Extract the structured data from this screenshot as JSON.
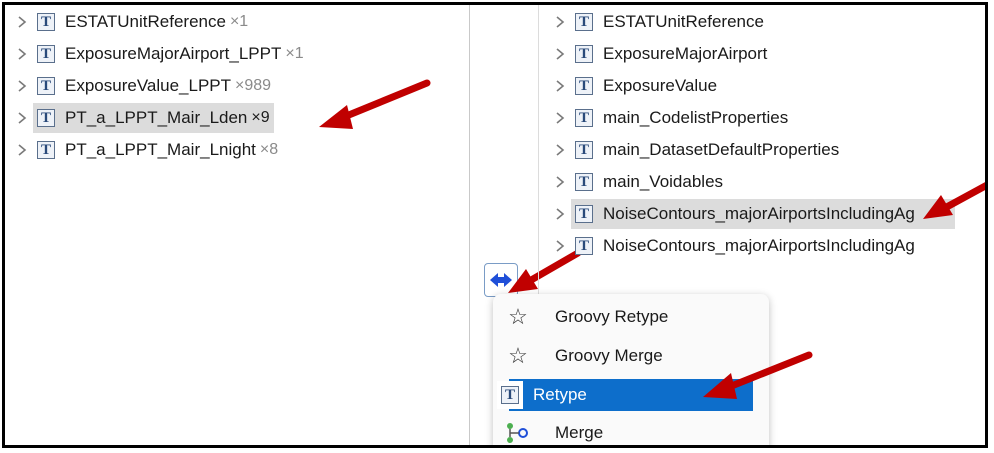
{
  "left_tree": {
    "items": [
      {
        "label": "ESTATUnitReference",
        "count": "×1",
        "selected": false
      },
      {
        "label": "ExposureMajorAirport_LPPT",
        "count": "×1",
        "selected": false
      },
      {
        "label": "ExposureValue_LPPT",
        "count": "×989",
        "selected": false
      },
      {
        "label": "PT_a_LPPT_Mair_Lden",
        "count": "×9",
        "selected": true
      },
      {
        "label": "PT_a_LPPT_Mair_Lnight",
        "count": "×8",
        "selected": false
      }
    ]
  },
  "right_tree": {
    "items": [
      {
        "label": "ESTATUnitReference",
        "selected": false
      },
      {
        "label": "ExposureMajorAirport",
        "selected": false
      },
      {
        "label": "ExposureValue",
        "selected": false
      },
      {
        "label": "main_CodelistProperties",
        "selected": false
      },
      {
        "label": "main_DatasetDefaultProperties",
        "selected": false
      },
      {
        "label": "main_Voidables",
        "selected": false
      },
      {
        "label": "NoiseContours_majorAirportsIncludingAg",
        "selected": true
      },
      {
        "label": "NoiseContours_majorAirportsIncludingAg",
        "selected": false
      }
    ]
  },
  "context_menu": {
    "items": [
      {
        "label": "Groovy Retype",
        "icon": "star-outline-icon",
        "active": false
      },
      {
        "label": "Groovy Merge",
        "icon": "star-outline-icon",
        "active": false
      },
      {
        "label": "Retype",
        "icon": "type-t-icon",
        "active": true
      },
      {
        "label": "Merge",
        "icon": "merge-icon",
        "active": false
      }
    ]
  },
  "colors": {
    "arrow": "#c00000",
    "selection": "#dcdcdc",
    "menu_active": "#0d6ecb"
  }
}
